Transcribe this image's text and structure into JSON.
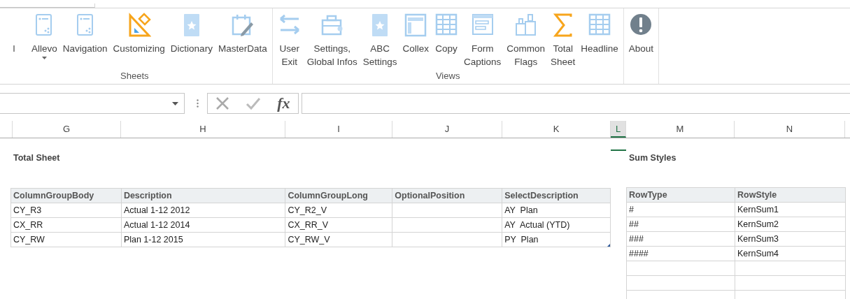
{
  "ribbon": {
    "groups": [
      {
        "label": "Sheets",
        "buttons": [
          {
            "label": "l",
            "kind": "cut"
          },
          {
            "label": "Allevo",
            "kind": "sheet",
            "dropdown": true
          },
          {
            "label": "Navigation",
            "kind": "sheet"
          },
          {
            "label": "Customizing",
            "kind": "ruler"
          },
          {
            "label": "Dictionary",
            "kind": "book"
          },
          {
            "label": "MasterData",
            "kind": "calendar"
          }
        ]
      },
      {
        "label": "Views",
        "buttons": [
          {
            "label": "User\nExit",
            "kind": "arrows"
          },
          {
            "label": "Settings,\nGlobal Infos",
            "kind": "toolbox"
          },
          {
            "label": "ABC\nSettings",
            "kind": "book"
          },
          {
            "label": "Collex",
            "kind": "panel"
          },
          {
            "label": "Copy",
            "kind": "grid"
          },
          {
            "label": "Form\nCaptions",
            "kind": "form"
          },
          {
            "label": "Common\nFlags",
            "kind": "boxes"
          },
          {
            "label": "Total\nSheet",
            "kind": "sigma"
          },
          {
            "label": "Headline",
            "kind": "grid"
          }
        ]
      },
      {
        "buttons": [
          {
            "label": "About",
            "kind": "info"
          }
        ]
      }
    ]
  },
  "formula_bar": {
    "function_label": "fx"
  },
  "columns": [
    {
      "label": "G",
      "selected": false
    },
    {
      "label": "H",
      "selected": false
    },
    {
      "label": "I",
      "selected": false
    },
    {
      "label": "J",
      "selected": false
    },
    {
      "label": "K",
      "selected": false
    },
    {
      "label": "L",
      "selected": true
    },
    {
      "label": "M",
      "selected": false
    },
    {
      "label": "N",
      "selected": false
    }
  ],
  "total_sheet": {
    "title": "Total Sheet",
    "columns": [
      "ColumnGroupBody",
      "Description",
      "ColumnGroupLong",
      "OptionalPosition",
      "SelectDescription"
    ],
    "rows": [
      [
        "CY_R3",
        "Actual 1-12 2012",
        "CY_R2_V",
        "",
        "AY  Plan"
      ],
      [
        "CX_RR",
        "Actual 1-12 2014",
        "CX_RR_V",
        "",
        "AY  Actual (YTD)"
      ],
      [
        "CY_RW",
        "Plan 1-12 2015",
        "CY_RW_V",
        "",
        "PY  Plan"
      ]
    ]
  },
  "sum_styles": {
    "title": "Sum Styles",
    "columns": [
      "RowType",
      "RowStyle"
    ],
    "rows": [
      [
        "#",
        "KernSum1"
      ],
      [
        "##",
        "KernSum2"
      ],
      [
        "###",
        "KernSum3"
      ],
      [
        "####",
        "KernSum4"
      ]
    ]
  }
}
